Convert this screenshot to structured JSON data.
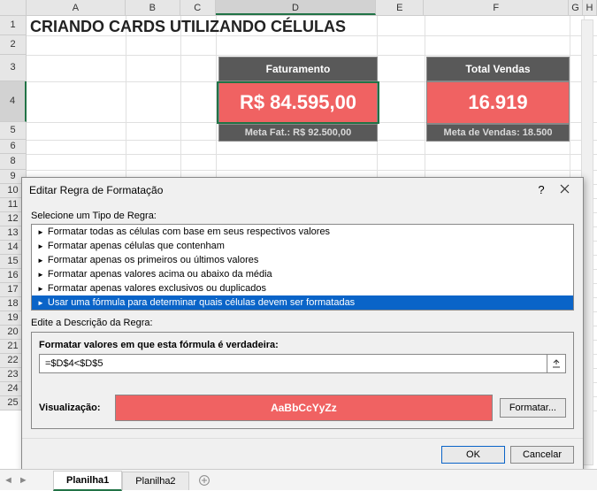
{
  "columns": [
    {
      "label": "A",
      "w": 112
    },
    {
      "label": "B",
      "w": 62
    },
    {
      "label": "C",
      "w": 40
    },
    {
      "label": "D",
      "w": 182,
      "selected": true
    },
    {
      "label": "E",
      "w": 54
    },
    {
      "label": "F",
      "w": 164
    },
    {
      "label": "G",
      "w": 16
    },
    {
      "label": "H",
      "w": 16
    }
  ],
  "rows": [
    {
      "n": 1,
      "h": 22
    },
    {
      "n": 2,
      "h": 22
    },
    {
      "n": 3,
      "h": 30
    },
    {
      "n": 4,
      "h": 46,
      "selected": true
    },
    {
      "n": 5,
      "h": 20
    },
    {
      "n": 6,
      "h": 16
    },
    {
      "n": 8,
      "h": 18
    },
    {
      "n": 9,
      "h": 16
    },
    {
      "n": 10,
      "h": 16
    },
    {
      "n": 11,
      "h": 16
    },
    {
      "n": 12,
      "h": 16
    },
    {
      "n": 13,
      "h": 16
    },
    {
      "n": 14,
      "h": 16
    },
    {
      "n": 15,
      "h": 16
    },
    {
      "n": 16,
      "h": 16
    },
    {
      "n": 17,
      "h": 16
    },
    {
      "n": 18,
      "h": 16
    },
    {
      "n": 19,
      "h": 16
    },
    {
      "n": 20,
      "h": 16
    },
    {
      "n": 21,
      "h": 16
    },
    {
      "n": 22,
      "h": 16
    },
    {
      "n": 23,
      "h": 16
    },
    {
      "n": 24,
      "h": 16
    },
    {
      "n": 25,
      "h": 16
    }
  ],
  "title": "CRIANDO CARDS UTILIZANDO CÉLULAS",
  "cards": {
    "fat": {
      "header": "Faturamento",
      "value": "R$ 84.595,00",
      "footer": "Meta Fat.: R$ 92.500,00"
    },
    "ven": {
      "header": "Total Vendas",
      "value": "16.919",
      "footer": "Meta de Vendas: 18.500"
    }
  },
  "dialog": {
    "title": "Editar Regra de Formatação",
    "help": "?",
    "select_label": "Selecione um Tipo de Regra:",
    "rules": [
      "Formatar todas as células com base em seus respectivos valores",
      "Formatar apenas células que contenham",
      "Formatar apenas os primeiros ou últimos valores",
      "Formatar apenas valores acima ou abaixo da média",
      "Formatar apenas valores exclusivos ou duplicados",
      "Usar uma fórmula para determinar quais células devem ser formatadas"
    ],
    "selected_rule_index": 5,
    "desc_label": "Edite a Descrição da Regra:",
    "formula_label": "Formatar valores em que esta fórmula é verdadeira:",
    "formula_value": "=$D$4<$D$5",
    "preview_label": "Visualização:",
    "preview_text": "AaBbCcYyZz",
    "format_btn": "Formatar...",
    "ok": "OK",
    "cancel": "Cancelar"
  },
  "tabs": {
    "t1": "Planilha1",
    "t2": "Planilha2"
  }
}
